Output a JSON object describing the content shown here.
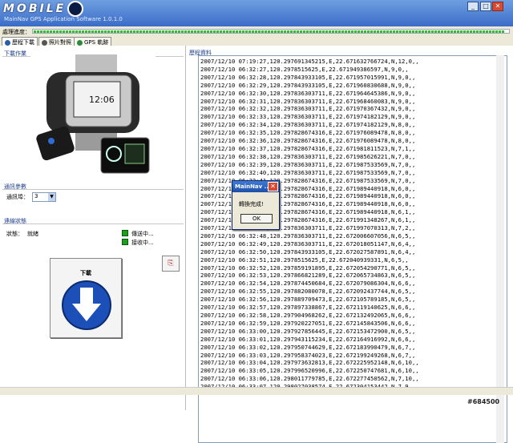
{
  "window": {
    "logo": "MOBILE",
    "subtitle": "MainNav GPS Application Software 1.0.1.0",
    "min": "_",
    "max": "□",
    "close": "✕"
  },
  "status_label": "處理進度：",
  "progress": 0.99,
  "tabs": [
    {
      "label": "歷程下載"
    },
    {
      "label": "照片對照"
    },
    {
      "label": "GPS 軌跡"
    }
  ],
  "left": {
    "group1": "下載作業",
    "group2": "通訊參數",
    "speed_label": "通訊埠：",
    "speed_value": "3",
    "group3": "連線狀態",
    "status_label": "狀態：",
    "status_value": "就緒",
    "led1": "傳送中...",
    "led2": "接收中...",
    "download_label": "下載"
  },
  "right": {
    "title": "歷程資料"
  },
  "log": [
    "2007/12/10 07:19:27,120.297691345215,E,22.671632766724,N,12,0,,",
    "2007/12/10 06:32:27,120.2978515625,E,22.671949386597,N,9,0,,",
    "2007/12/10 06:32:28,120.297843933105,E,22.671957015991,N,9,0,,",
    "2007/12/10 06:32:29,120.297843933105,E,22.671960830688,N,9,0,,",
    "2007/12/10 06:32:30,120.297836303711,E,22.671964645386,N,9,0,,",
    "2007/12/10 06:32:31,120.297836303711,E,22.671968460083,N,9,0,,",
    "2007/12/10 06:32:32,120.297836303711,E,22.671970367432,N,9,0,,",
    "2007/12/10 06:32:33,120.297836303711,E,22.671974182129,N,9,0,,",
    "2007/12/10 06:32:34,120.297836303711,E,22.671974182129,N,8,0,,",
    "2007/12/10 06:32:35,120.297828674316,E,22.671976089478,N,8,0,,",
    "2007/12/10 06:32:36,120.297828674316,E,22.671976089478,N,8,0,,",
    "2007/12/10 06:32:37,120.297828674316,E,22.671981811523,N,7,1,,",
    "2007/12/10 06:32:38,120.297836303711,E,22.671985626221,N,7,0,,",
    "2007/12/10 06:32:39,120.297836303711,E,22.671987533569,N,7,0,,",
    "2007/12/10 06:32:40,120.297836303711,E,22.671987533569,N,7,0,,",
    "2007/12/10 06:32:41,120.297828674316,E,22.671987533569,N,7,0,,",
    "2007/12/10 06:32:42,120.297828674316,E,22.671989440918,N,6,0,,",
    "2007/12/10 06:32:43,120.297828674316,E,22.671989440918,N,6,0,,",
    "2007/12/10 06:32:44,120.297828674316,E,22.671989440918,N,6,0,,",
    "2007/12/10 06:32:45,120.297828674316,E,22.671989440918,N,6,1,,",
    "2007/12/10 06:32:46,120.297828674316,E,22.671991348267,N,6,1,,",
    "2007/12/10 06:32:47,120.297836303711,E,22.671997070313,N,7,2,,",
    "2007/12/10 06:32:48,120.297836303711,E,22.672006607056,N,6,5,,",
    "2007/12/10 06:32:49,120.297836303711,E,22.672018051147,N,6,4,,",
    "2007/12/10 06:32:50,120.297843933105,E,22.672027587891,N,6,4,,",
    "2007/12/10 06:32:51,120.2978515625,E,22.672040939331,N,6,5,,",
    "2007/12/10 06:32:52,120.297859191895,E,22.672054290771,N,6,5,,",
    "2007/12/10 06:32:53,120.297866821289,E,22.672065734863,N,6,5,,",
    "2007/12/10 06:32:54,120.297874450684,E,22.672079086304,N,6,6,,",
    "2007/12/10 06:32:55,120.297882080078,E,22.672092437744,N,6,5,,",
    "2007/12/10 06:32:56,120.297889709473,E,22.672105789185,N,6,5,,",
    "2007/12/10 06:32:57,120.297897338867,E,22.672119140625,N,6,6,,",
    "2007/12/10 06:32:58,120.297904968262,E,22.672132492065,N,6,6,,",
    "2007/12/10 06:32:59,120.297920227051,E,22.672145843506,N,6,6,,",
    "2007/12/10 06:33:00,120.297927856445,E,22.672153472900,N,6,5,,",
    "2007/12/10 06:33:01,120.297943115234,E,22.672164916992,N,6,6,,",
    "2007/12/10 06:33:02,120.297950744629,E,22.672183990479,N,6,7,,",
    "2007/12/10 06:33:03,120.297958374023,E,22.672199249268,N,6,7,,",
    "2007/12/10 06:33:04,120.297973632813,E,22.672225952148,N,6,10,,",
    "2007/12/10 06:33:05,120.297996520996,E,22.672250747681,N,6,10,,",
    "2007/12/10 06:33:06,120.298011779785,E,22.672277450562,N,7,10,,",
    "2007/12/10 06:33:07,120.298027038574,E,22.672304153442,N,7,9,,"
  ],
  "dialog": {
    "title": "MainNav ...",
    "message": "轉換完成!",
    "ok": "OK"
  },
  "corner_id": "#684500",
  "colors": {
    "title_bar": "#3a6cc8",
    "progress": "#2fbf2f",
    "led": "#1b9e1b",
    "download_icon": "#1d4fb8"
  }
}
